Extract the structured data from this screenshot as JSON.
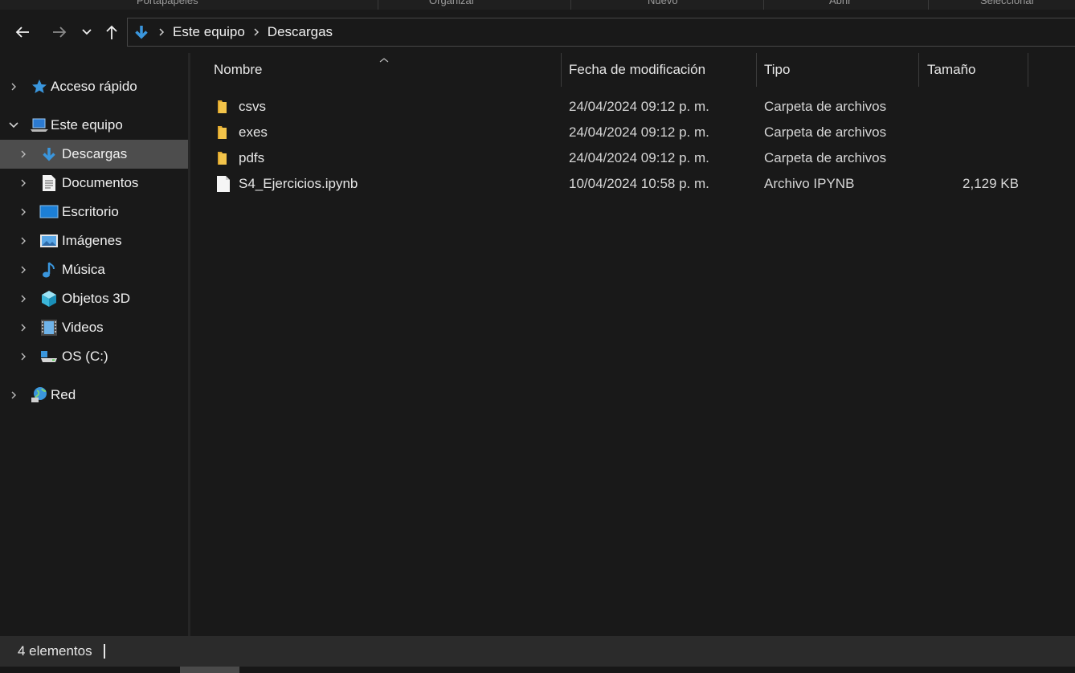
{
  "ribbon": {
    "groups": [
      "Portapapeles",
      "Organizar",
      "Nuevo",
      "Abrir",
      "Seleccionar"
    ]
  },
  "navigation": {
    "back_icon": "arrow-left-icon",
    "forward_icon": "arrow-right-icon",
    "recent_icon": "chevron-down-icon",
    "up_icon": "arrow-up-icon"
  },
  "address_bar": {
    "location_icon": "download-arrow-icon",
    "crumbs": [
      "Este equipo",
      "Descargas"
    ]
  },
  "nav_pane": {
    "items": [
      {
        "label": "Acceso rápido",
        "icon": "star-icon",
        "expanded": false,
        "level": 0
      },
      {
        "label": "Este equipo",
        "icon": "computer-icon",
        "expanded": true,
        "level": 0
      },
      {
        "label": "Descargas",
        "icon": "download-arrow-icon",
        "expanded": false,
        "level": 1,
        "selected": true
      },
      {
        "label": "Documentos",
        "icon": "document-icon",
        "expanded": false,
        "level": 1
      },
      {
        "label": "Escritorio",
        "icon": "desktop-icon",
        "expanded": false,
        "level": 1
      },
      {
        "label": "Imágenes",
        "icon": "picture-icon",
        "expanded": false,
        "level": 1
      },
      {
        "label": "Música",
        "icon": "music-note-icon",
        "expanded": false,
        "level": 1
      },
      {
        "label": "Objetos 3D",
        "icon": "cube-icon",
        "expanded": false,
        "level": 1
      },
      {
        "label": "Videos",
        "icon": "film-icon",
        "expanded": false,
        "level": 1
      },
      {
        "label": "OS (C:)",
        "icon": "drive-icon",
        "expanded": false,
        "level": 1
      },
      {
        "label": "Red",
        "icon": "network-globe-icon",
        "expanded": false,
        "level": 0
      }
    ]
  },
  "file_list": {
    "columns": [
      "Nombre",
      "Fecha de modificación",
      "Tipo",
      "Tamaño"
    ],
    "sorted_by": "Nombre",
    "rows": [
      {
        "name": "csvs",
        "date": "24/04/2024 09:12 p. m.",
        "type": "Carpeta de archivos",
        "size": "",
        "icon": "folder-icon"
      },
      {
        "name": "exes",
        "date": "24/04/2024 09:12 p. m.",
        "type": "Carpeta de archivos",
        "size": "",
        "icon": "folder-icon"
      },
      {
        "name": "pdfs",
        "date": "24/04/2024 09:12 p. m.",
        "type": "Carpeta de archivos",
        "size": "",
        "icon": "folder-icon"
      },
      {
        "name": "S4_Ejercicios.ipynb",
        "date": "10/04/2024 10:58 p. m.",
        "type": "Archivo IPYNB",
        "size": "2,129 KB",
        "icon": "file-icon"
      }
    ]
  },
  "status_bar": {
    "item_count": "4 elementos"
  },
  "colors": {
    "background": "#191919",
    "selection": "#4d4d4d",
    "accent_blue": "#3a96dd",
    "folder_yellow": "#f3c44a"
  }
}
